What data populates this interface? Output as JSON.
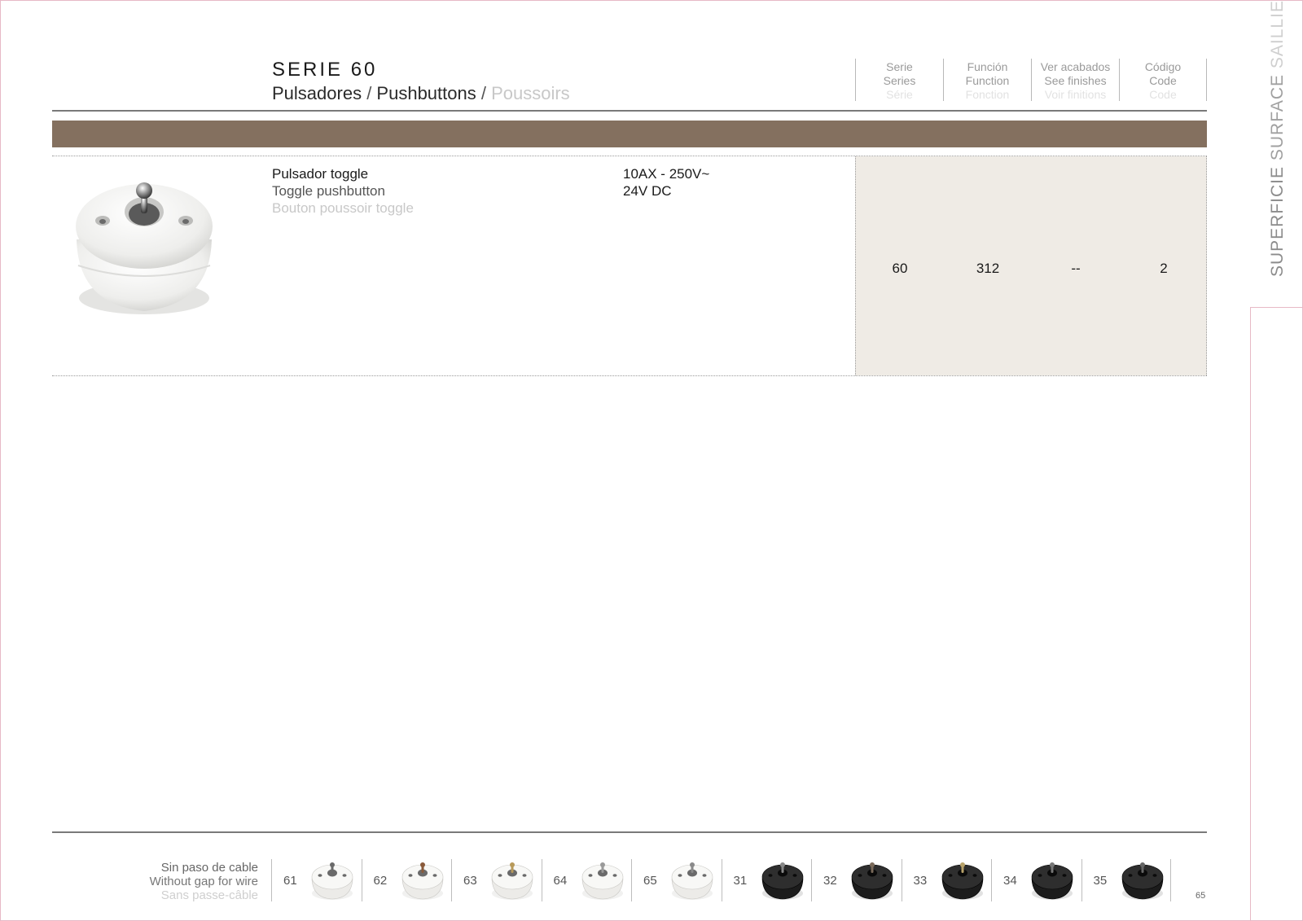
{
  "header": {
    "series_title": "SERIE 60",
    "subtitle_es": "Pulsadores",
    "subtitle_sep1": " / ",
    "subtitle_en": "Pushbuttons",
    "subtitle_sep2": " / ",
    "subtitle_fr": "Poussoirs"
  },
  "columns": [
    {
      "es": "Serie",
      "en": "Series",
      "fr": "Série"
    },
    {
      "es": "Función",
      "en": "Function",
      "fr": "Fonction"
    },
    {
      "es": "Ver acabados",
      "en": "See finishes",
      "fr": "Voir finitions"
    },
    {
      "es": "Código",
      "en": "Code",
      "fr": "Code"
    }
  ],
  "product": {
    "name_es": "Pulsador  toggle",
    "name_en": "Toggle pushbutton",
    "name_fr": "Bouton poussoir toggle",
    "spec_line1": "10AX - 250V~",
    "spec_line2": "24V DC",
    "serie": "60",
    "funcion": "312",
    "acabados": "--",
    "codigo": "2"
  },
  "side_label": {
    "es": "SUPERFICIE",
    "en": "SURFACE",
    "fr": "SAILLIE"
  },
  "footer": {
    "legend_es": "Sin paso de cable",
    "legend_en": "Without gap for wire",
    "legend_fr": "Sans passe-câble",
    "finishes": [
      {
        "code": "61",
        "color": "white",
        "toggle": "#6a6a6a"
      },
      {
        "code": "62",
        "color": "white",
        "toggle": "#8a5a3a"
      },
      {
        "code": "63",
        "color": "white",
        "toggle": "#b89a5a"
      },
      {
        "code": "64",
        "color": "white",
        "toggle": "#9a9a9a"
      },
      {
        "code": "65",
        "color": "white",
        "toggle": "#8a8a8a"
      },
      {
        "code": "31",
        "color": "black",
        "toggle": "#888888"
      },
      {
        "code": "32",
        "color": "black",
        "toggle": "#7a6a5a"
      },
      {
        "code": "33",
        "color": "black",
        "toggle": "#b8a26a"
      },
      {
        "code": "34",
        "color": "black",
        "toggle": "#777777"
      },
      {
        "code": "35",
        "color": "black",
        "toggle": "#666666"
      }
    ]
  },
  "page_number": "65",
  "colors": {
    "band_brown": "#84705f",
    "code_box_bg": "#efebe5"
  }
}
